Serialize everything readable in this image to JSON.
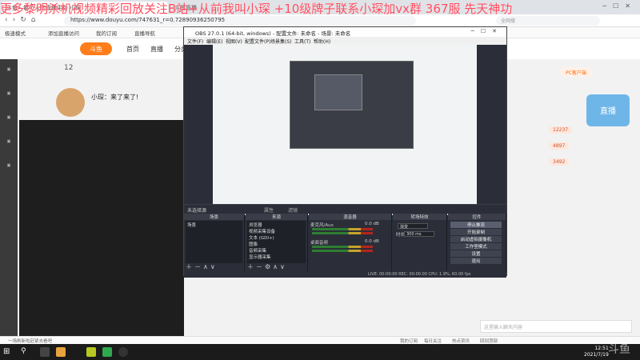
{
  "browser": {
    "tab_active": "斗鱼 - 每个人的直播平台 小琛",
    "tab_second": "斗鱼直播",
    "url": "https://www.douyu.com/747631_r=0.72890936250795",
    "search_placeholder": "全网搜"
  },
  "bookmarks": [
    "极速模式",
    "添加直播访问",
    "我的订阅",
    "直播导航"
  ],
  "site": {
    "logo": "斗鱼",
    "nav": [
      "首页",
      "直播",
      "分类"
    ],
    "streamer_name": "小琛：来了来了!",
    "follow_count": "12",
    "pc_client": "PC客户端",
    "promo": "直播",
    "chat_placeholder": "这里输入聊天内容",
    "right_rows": [
      "12237",
      "4897",
      "3492"
    ]
  },
  "marquee": "更多黎明杀机视频精彩回放关注B站+从前我叫小琛 +10级牌子联系小琛加vx群   367服  先天神功",
  "obs": {
    "title": "OBS 27.0.1 (64-bit, windows) - 配置文件: 未命名 - 场景: 未命名",
    "menu": [
      "文件(F)",
      "编辑(E)",
      "视图(V)",
      "配置文件(P)",
      "场景集(S)",
      "工具(T)",
      "帮助(H)"
    ],
    "no_source": "未选择源",
    "props_tabs": [
      "属性",
      "滤镜"
    ],
    "docks": {
      "scenes": {
        "title": "场景",
        "items": [
          "场景"
        ]
      },
      "sources": {
        "title": "来源",
        "items": [
          "浏览器",
          "视频采集设备",
          "文本 (GDI+)",
          "图像",
          "音频采集",
          "显示器采集"
        ]
      },
      "mixer": {
        "title": "混音器",
        "rows": [
          "麦克风/Aux",
          "桌面音频"
        ],
        "db": [
          "0.0 dB",
          "0.0 dB"
        ]
      },
      "transitions": {
        "title": "转场特效",
        "type": "渐变",
        "duration_label": "时长",
        "duration": "300 ms"
      },
      "controls": {
        "title": "控件",
        "buttons": [
          "停止推流",
          "开始录制",
          "启动虚拟摄像机",
          "工作室模式",
          "设置",
          "退出"
        ]
      }
    },
    "status": "LIVE: 00:00:00   REC: 00:00:00   CPU: 1.9%, 60.00 fps"
  },
  "notify": [
    "一场刷新啦赶紧去看吧",
    "我的订阅",
    "每日关注",
    "热点资讯",
    "回到顶部"
  ],
  "taskbar": {
    "time": "12:51",
    "date": "2021/7/19",
    "watermark": "斗鱼"
  }
}
